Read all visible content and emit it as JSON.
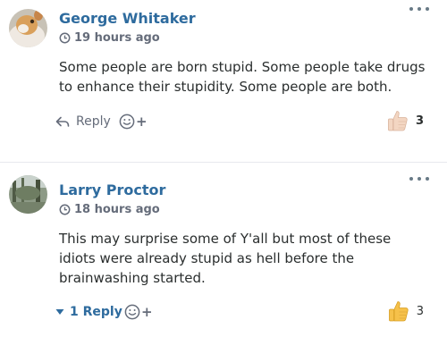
{
  "comments": [
    {
      "author": "George Whitaker",
      "time": "19 hours ago",
      "text": "Some people are born stupid. Some people take drugs to enhance their stupidity. Some people are both.",
      "reply_label": "Reply",
      "react_plus": "+",
      "like_count": "3",
      "like_color": "#f3d6c2"
    },
    {
      "author": "Larry Proctor",
      "time": "18 hours ago",
      "text": "This may surprise some of Y'all but most of these idiots were already stupid as hell before the brainwashing started.",
      "reply_label": "1 Reply",
      "react_plus": "+",
      "like_count": "3",
      "like_color": "#f6c14a"
    }
  ],
  "colors": {
    "author": "#2e6b9e",
    "meta": "#656c7a",
    "text": "#2a2e2e"
  },
  "icons": {
    "more": "more-dots-icon",
    "clock": "clock-icon",
    "reply": "reply-arrow-icon",
    "expand": "triangle-down-icon",
    "react": "smiley-add-icon",
    "like": "thumbs-up-icon"
  }
}
